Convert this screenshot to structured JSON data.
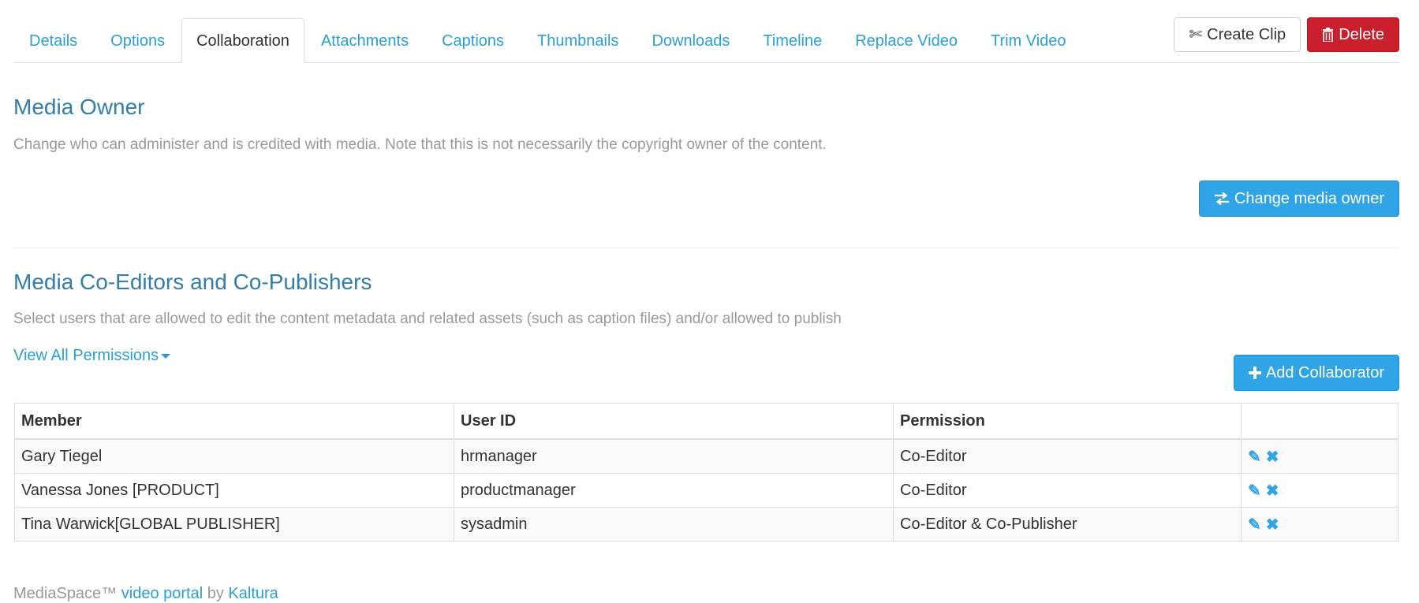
{
  "tabs": [
    {
      "label": "Details"
    },
    {
      "label": "Options"
    },
    {
      "label": "Collaboration"
    },
    {
      "label": "Attachments"
    },
    {
      "label": "Captions"
    },
    {
      "label": "Thumbnails"
    },
    {
      "label": "Downloads"
    },
    {
      "label": "Timeline"
    },
    {
      "label": "Replace Video"
    },
    {
      "label": "Trim Video"
    }
  ],
  "active_tab": "Collaboration",
  "actions": {
    "create_clip_label": "Create Clip",
    "delete_label": "Delete"
  },
  "owner": {
    "heading": "Media Owner",
    "description": "Change who can administer and is credited with media. Note that this is not necessarily the copyright owner of the content.",
    "change_button": "Change media owner"
  },
  "coeditors": {
    "heading": "Media Co-Editors and Co-Publishers",
    "description": "Select users that are allowed to edit the content metadata and related assets (such as caption files) and/or allowed to publish",
    "view_permissions": "View All Permissions",
    "add_button": "Add Collaborator",
    "columns": [
      "Member",
      "User ID",
      "Permission",
      ""
    ],
    "rows": [
      {
        "member": "Gary Tiegel",
        "user_id": "hrmanager",
        "permission": "Co-Editor"
      },
      {
        "member": "Vanessa Jones [PRODUCT]",
        "user_id": "productmanager",
        "permission": "Co-Editor"
      },
      {
        "member": "Tina Warwick[GLOBAL PUBLISHER]",
        "user_id": "sysadmin",
        "permission": "Co-Editor & Co-Publisher"
      }
    ]
  },
  "footer": {
    "prefix": "MediaSpace™ ",
    "portal_link": "video portal",
    "by": " by ",
    "kaltura_link": "Kaltura"
  },
  "colors": {
    "link": "#2a9fd6",
    "heading": "#317eac",
    "primary": "#2fa4e7",
    "danger": "#cc1f2d"
  },
  "icons": {
    "create_clip": "scissors-icon",
    "delete": "trash-icon",
    "change_owner": "swap-arrows-icon",
    "add": "plus-icon",
    "edit": "pencil-icon",
    "remove": "x-icon",
    "dropdown": "caret-down-icon"
  }
}
